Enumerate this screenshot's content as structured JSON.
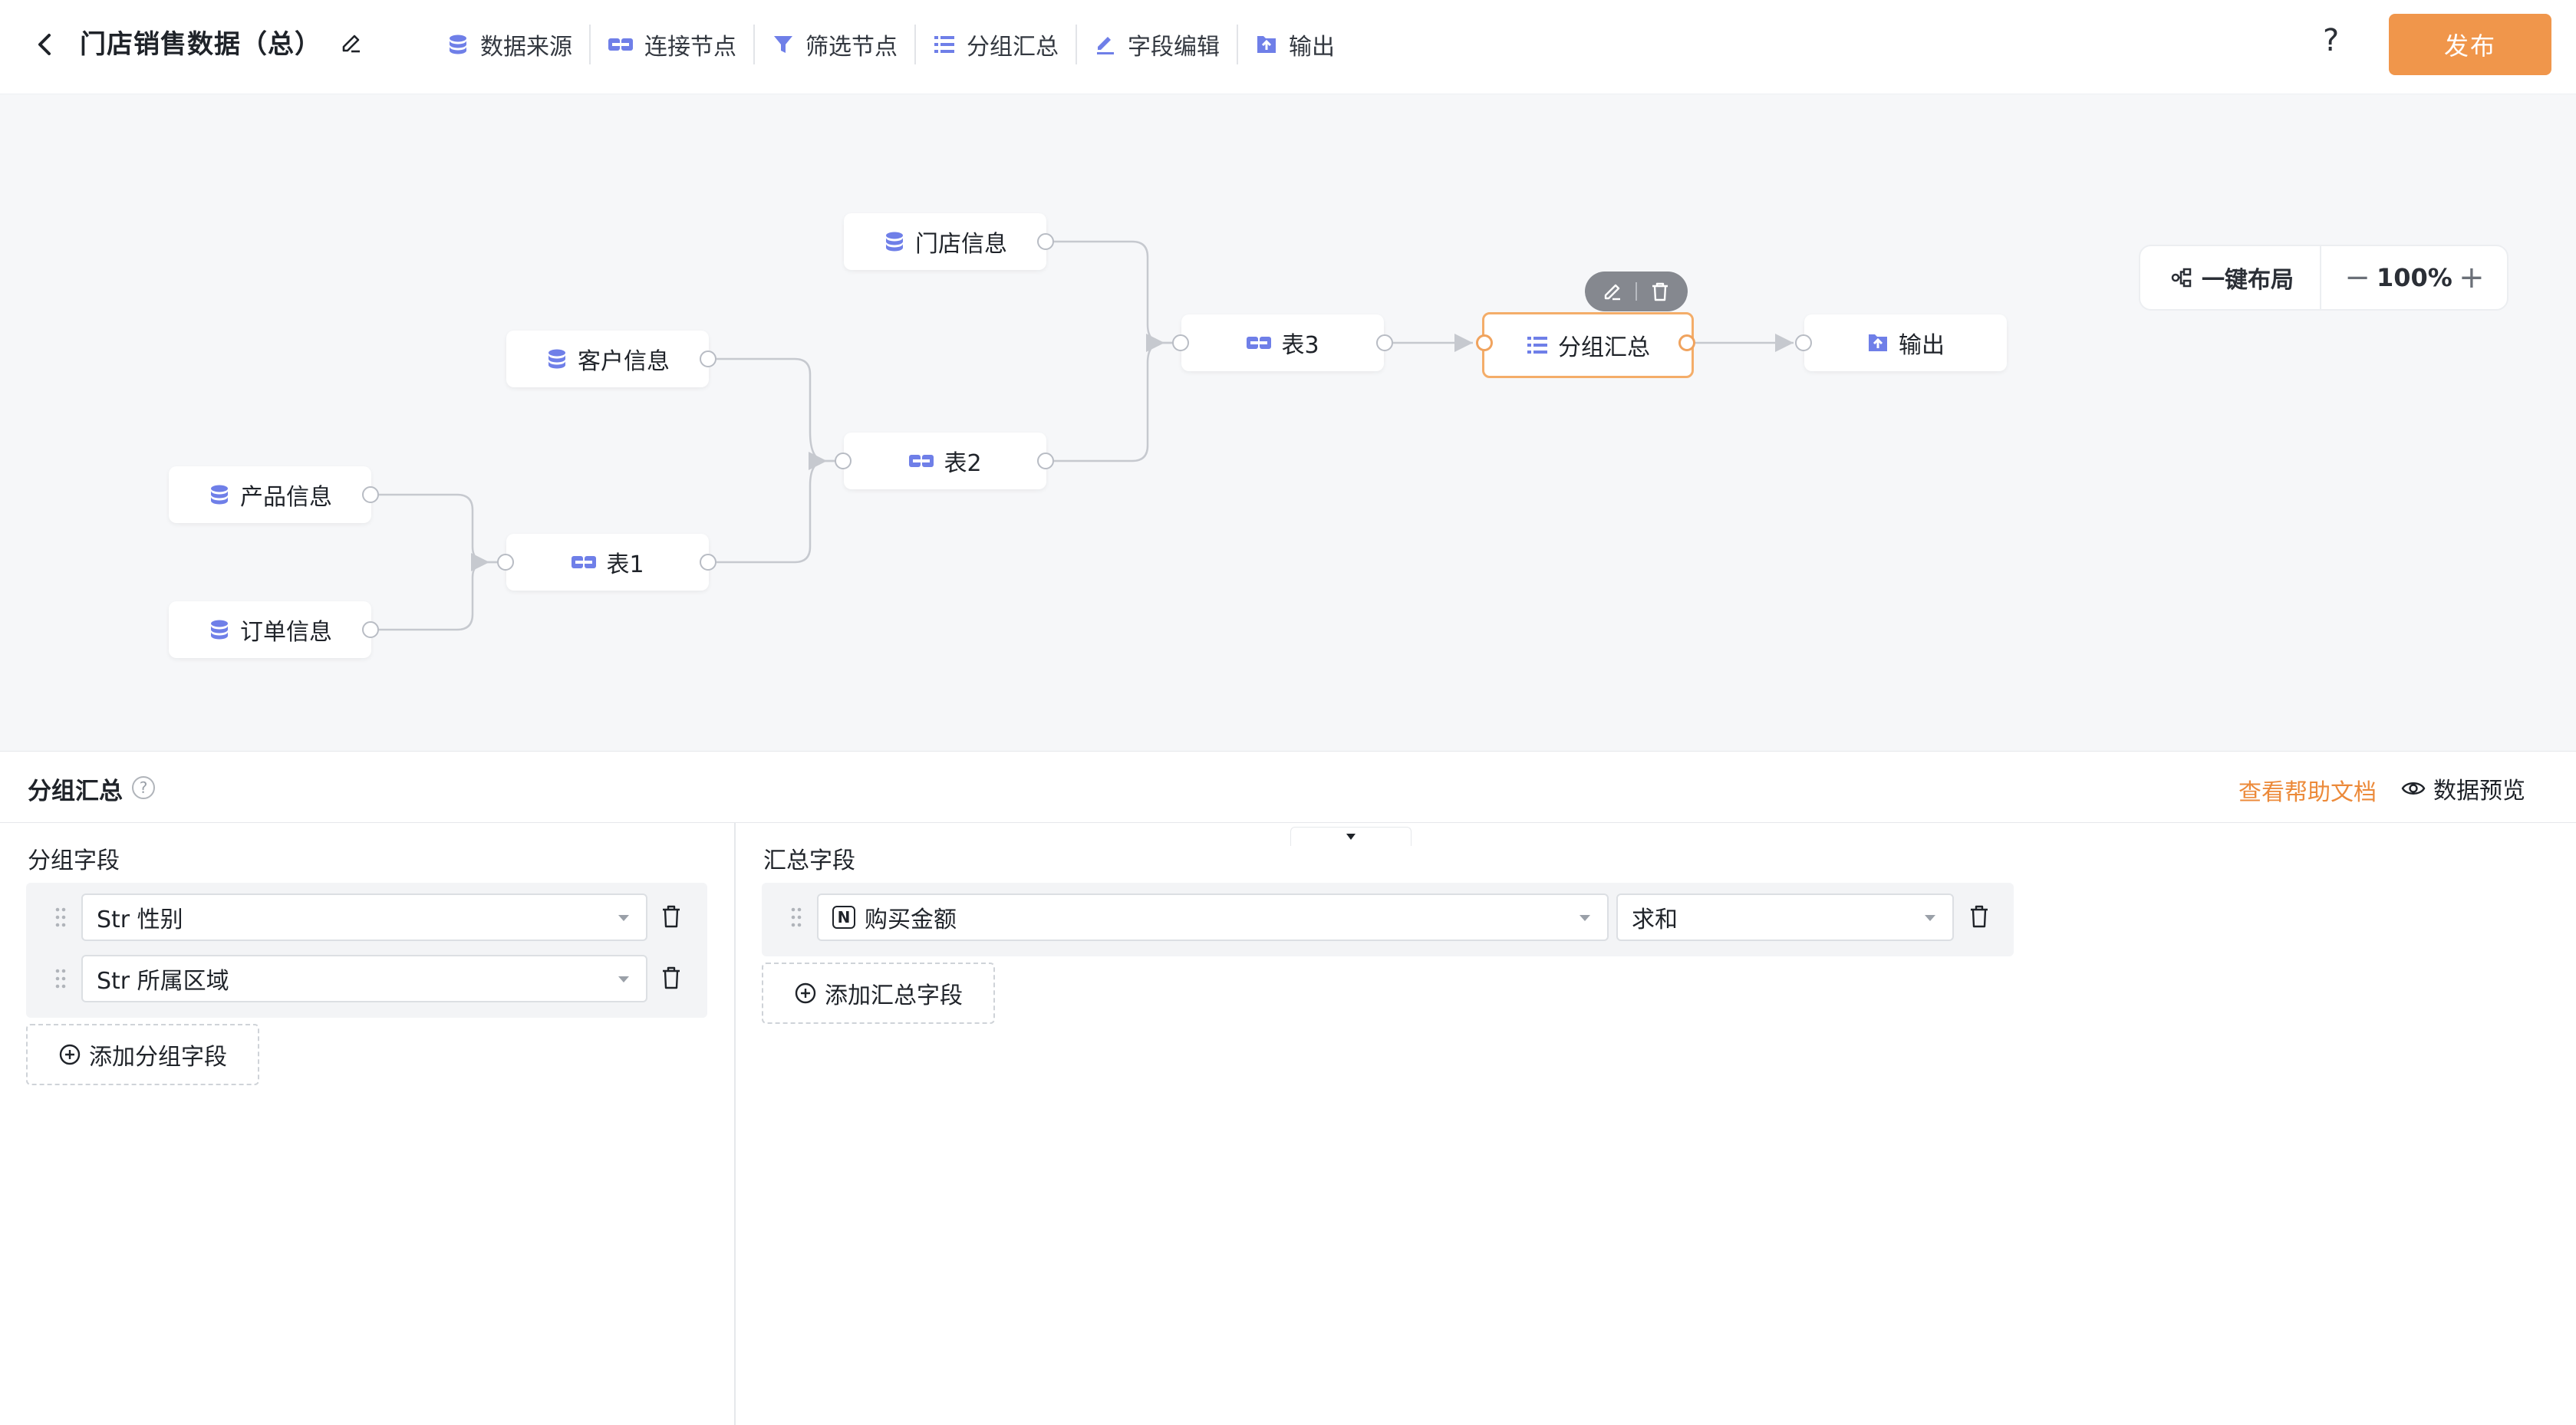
{
  "header": {
    "title": "门店销售数据（总）",
    "tools": [
      {
        "label": "数据来源",
        "icon": "database-icon"
      },
      {
        "label": "连接节点",
        "icon": "join-icon"
      },
      {
        "label": "筛选节点",
        "icon": "filter-icon"
      },
      {
        "label": "分组汇总",
        "icon": "group-icon"
      },
      {
        "label": "字段编辑",
        "icon": "edit-icon"
      },
      {
        "label": "输出",
        "icon": "output-icon"
      }
    ],
    "help": "?",
    "publish": "发布"
  },
  "canvas": {
    "layout_button": "一键布局",
    "zoom_minus": "−",
    "zoom_value": "100%",
    "zoom_plus": "+",
    "nodes": {
      "store_info": "门店信息",
      "customer_info": "客户信息",
      "product_info": "产品信息",
      "order_info": "订单信息",
      "table1": "表1",
      "table2": "表2",
      "table3": "表3",
      "group_summary": "分组汇总",
      "output": "输出"
    },
    "selected_node": "分组汇总"
  },
  "panel": {
    "title": "分组汇总",
    "help_doc": "查看帮助文档",
    "data_preview": "数据预览",
    "group_fields_label": "分组字段",
    "group_fields": [
      {
        "value": "Str 性别"
      },
      {
        "value": "Str 所属区域"
      }
    ],
    "add_group_field": "添加分组字段",
    "summary_fields_label": "汇总字段",
    "summary_fields": [
      {
        "type_badge": "N",
        "field": "购买金额",
        "agg": "求和"
      }
    ],
    "add_summary_field": "添加汇总字段"
  },
  "colors": {
    "accent": "#f0964b",
    "node_icon": "#6f7fe8",
    "selected_border": "#f4ad69",
    "link": "#ec8a3a"
  }
}
